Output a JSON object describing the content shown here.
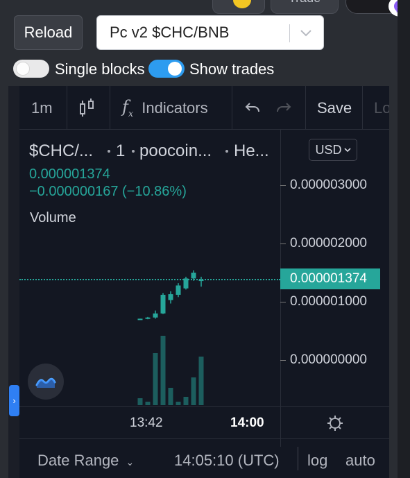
{
  "top": {
    "trade_label": "Trade"
  },
  "controls": {
    "reload_label": "Reload",
    "pair_value": "Pc v2 $CHC/BNB",
    "toggle_single_blocks": {
      "label": "Single blocks",
      "on": false
    },
    "toggle_show_trades": {
      "label": "Show trades",
      "on": true
    }
  },
  "chart": {
    "toolbar": {
      "interval": "1m",
      "indicators_label": "Indicators",
      "save_label": "Save",
      "load_label": "Lo"
    },
    "legend": {
      "symbol": "$CHC/...",
      "interval": "1",
      "source": "poocoin...",
      "extra": "He...",
      "price": "0.000001374",
      "change": "−0.000000167 (−10.86%)",
      "volume_label": "Volume"
    },
    "currency_button": "USD",
    "y_axis_labels": [
      "0.000003000",
      "0.000002000",
      "0.000001000",
      "0.000000000"
    ],
    "last_price_label": "0.000001374",
    "x_axis_labels": [
      "13:42",
      "14:00"
    ],
    "bottom_bar": {
      "date_range_label": "Date Range",
      "time_label": "14:05:10 (UTC)",
      "log_label": "log",
      "auto_label": "auto"
    },
    "colors": {
      "up": "#26a69a",
      "background": "#131722",
      "accent": "#2d9cf0"
    }
  },
  "chart_data": {
    "type": "candlestick",
    "x_labels": [
      "13:42",
      "14:00"
    ],
    "ylim": [
      0,
      3e-06
    ],
    "y_ticks": [
      3e-06,
      2e-06,
      1e-06,
      0
    ],
    "last_price": 1.374e-06,
    "candles": [
      {
        "o": 7e-07,
        "h": 7.1e-07,
        "l": 6.9e-07,
        "c": 7.1e-07
      },
      {
        "o": 7.1e-07,
        "h": 7.4e-07,
        "l": 7e-07,
        "c": 7.3e-07
      },
      {
        "o": 7.3e-07,
        "h": 8.5e-07,
        "l": 7.1e-07,
        "c": 8e-07
      },
      {
        "o": 8e-07,
        "h": 1.15e-06,
        "l": 7.9e-07,
        "c": 1.12e-06
      },
      {
        "o": 1.03e-06,
        "h": 1.18e-06,
        "l": 9.7e-07,
        "c": 1.13e-06
      },
      {
        "o": 1.12e-06,
        "h": 1.32e-06,
        "l": 1.08e-06,
        "c": 1.28e-06
      },
      {
        "o": 1.23e-06,
        "h": 1.43e-06,
        "l": 1.21e-06,
        "c": 1.4e-06
      },
      {
        "o": 1.4e-06,
        "h": 1.54e-06,
        "l": 1.36e-06,
        "c": 1.5e-06
      },
      {
        "o": 1.37e-06,
        "h": 1.43e-06,
        "l": 1.26e-06,
        "c": 1.38e-06
      }
    ],
    "volumes": [
      0.1,
      0.05,
      0.75,
      1.0,
      0.25,
      0.05,
      0.12,
      0.4,
      0.7
    ]
  }
}
